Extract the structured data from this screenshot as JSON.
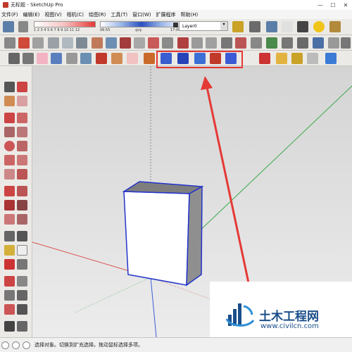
{
  "window": {
    "title": "无标题 - SketchUp Pro",
    "controls": [
      "—",
      "☐",
      "✕"
    ]
  },
  "menu": [
    "文件(F)",
    "编辑(E)",
    "视图(V)",
    "相机(C)",
    "绘图(R)",
    "工具(T)",
    "窗口(W)",
    "扩展程序",
    "帮助(H)"
  ],
  "toolbar1": {
    "shadow_scale": "1 2 3 4 5 6 7 8 9 10 11 12",
    "time_start": "06:55",
    "time_mid": "中午",
    "time_end": "17:00",
    "layer_value": "Layer0"
  },
  "status": {
    "message": "选择对象。切换到扩充选择。拖动鼠标选择多项。"
  },
  "watermark": {
    "title": "土木工程网",
    "url": "www.civilcn.com"
  },
  "colors": {
    "accent_red": "#e53935",
    "axis_red": "#d9534f",
    "axis_green": "#3aa84a",
    "axis_blue": "#3b5bd6",
    "brand_blue": "#1a4e8a"
  }
}
